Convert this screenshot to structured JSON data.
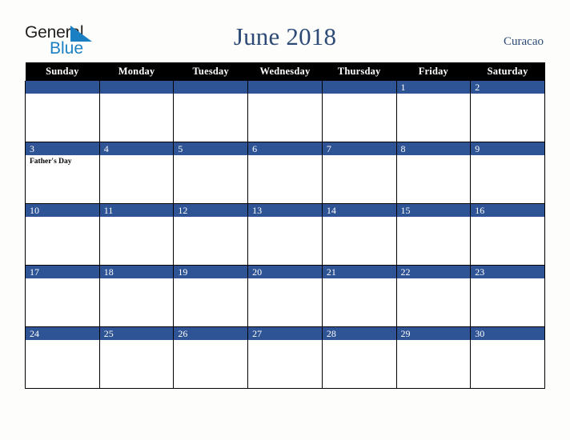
{
  "brand": {
    "word_one": "General",
    "word_two": "Blue",
    "triangle_icon": "triangle-icon",
    "word_one_color": "#231f20",
    "word_two_color": "#1b7fc3",
    "triangle_color": "#1b7fc3"
  },
  "header": {
    "title": "June 2018",
    "locale": "Curacao",
    "title_color": "#2d4a77"
  },
  "calendar": {
    "accent_color": "#2e5496",
    "header_bg": "#000000",
    "weekday_headers": [
      "Sunday",
      "Monday",
      "Tuesday",
      "Wednesday",
      "Thursday",
      "Friday",
      "Saturday"
    ],
    "weeks": [
      [
        {
          "day": "",
          "events": []
        },
        {
          "day": "",
          "events": []
        },
        {
          "day": "",
          "events": []
        },
        {
          "day": "",
          "events": []
        },
        {
          "day": "",
          "events": []
        },
        {
          "day": "1",
          "events": []
        },
        {
          "day": "2",
          "events": []
        }
      ],
      [
        {
          "day": "3",
          "events": [
            "Father's Day"
          ]
        },
        {
          "day": "4",
          "events": []
        },
        {
          "day": "5",
          "events": []
        },
        {
          "day": "6",
          "events": []
        },
        {
          "day": "7",
          "events": []
        },
        {
          "day": "8",
          "events": []
        },
        {
          "day": "9",
          "events": []
        }
      ],
      [
        {
          "day": "10",
          "events": []
        },
        {
          "day": "11",
          "events": []
        },
        {
          "day": "12",
          "events": []
        },
        {
          "day": "13",
          "events": []
        },
        {
          "day": "14",
          "events": []
        },
        {
          "day": "15",
          "events": []
        },
        {
          "day": "16",
          "events": []
        }
      ],
      [
        {
          "day": "17",
          "events": []
        },
        {
          "day": "18",
          "events": []
        },
        {
          "day": "19",
          "events": []
        },
        {
          "day": "20",
          "events": []
        },
        {
          "day": "21",
          "events": []
        },
        {
          "day": "22",
          "events": []
        },
        {
          "day": "23",
          "events": []
        }
      ],
      [
        {
          "day": "24",
          "events": []
        },
        {
          "day": "25",
          "events": []
        },
        {
          "day": "26",
          "events": []
        },
        {
          "day": "27",
          "events": []
        },
        {
          "day": "28",
          "events": []
        },
        {
          "day": "29",
          "events": []
        },
        {
          "day": "30",
          "events": []
        }
      ]
    ]
  }
}
